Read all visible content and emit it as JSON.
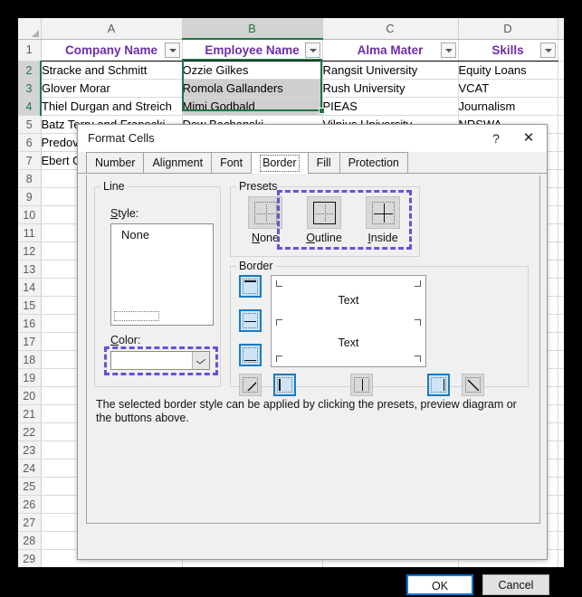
{
  "spreadsheet": {
    "columns": [
      "A",
      "B",
      "C",
      "D"
    ],
    "selected_column": "B",
    "row_count": 30,
    "selected_rows": [
      2,
      3,
      4
    ],
    "headers": [
      "Company Name",
      "Employee Name",
      "Alma Mater",
      "Skills"
    ],
    "header_text_color": "#6f2da8",
    "selection_color": "#217346",
    "rows": [
      [
        "Stracke and Schmitt",
        "Ozzie Gilkes",
        "Rangsit University",
        "Equity Loans"
      ],
      [
        "Glover Morar",
        "Romola Gallanders",
        "Rush University",
        "VCAT"
      ],
      [
        "Thiel Durgan and Streich",
        "Mimi Godbald",
        " PIEAS",
        "Journalism"
      ],
      [
        "Batz Terry and Franecki",
        "Dew Bachanski",
        "Vilnius University",
        "NRSWA"
      ],
      [
        "Predov",
        "",
        "",
        ""
      ],
      [
        "Ebert G",
        "",
        "",
        ""
      ]
    ],
    "filter_icon": "filter-dropdown-icon"
  },
  "dialog": {
    "title": "Format Cells",
    "help_icon": "?",
    "close_icon": "✕",
    "tabs": [
      {
        "label": "Number",
        "active": false
      },
      {
        "label": "Alignment",
        "active": false
      },
      {
        "label": "Font",
        "active": false
      },
      {
        "label": "Border",
        "active": true
      },
      {
        "label": "Fill",
        "active": false
      },
      {
        "label": "Protection",
        "active": false
      }
    ],
    "line_group": {
      "legend": "Line",
      "style_label": "Style:",
      "style_accel": "S",
      "style_options": [
        "None"
      ],
      "style_selected": "None",
      "color_label": "Color:",
      "color_accel": "C",
      "color_value": ""
    },
    "presets_group": {
      "legend": "Presets",
      "items": [
        {
          "label": "None",
          "accel": "N",
          "icon": "preset-none-icon"
        },
        {
          "label": "Outline",
          "accel": "O",
          "icon": "preset-outline-icon"
        },
        {
          "label": "Inside",
          "accel": "I",
          "icon": "preset-inside-icon"
        }
      ]
    },
    "border_group": {
      "legend": "Border",
      "preview_text_1": "Text",
      "preview_text_2": "Text",
      "side_buttons": [
        {
          "name": "border-top-button",
          "selected": true
        },
        {
          "name": "border-horizontal-middle-button",
          "selected": true
        },
        {
          "name": "border-bottom-button",
          "selected": true
        }
      ],
      "bottom_buttons": [
        {
          "name": "border-diagonal-up-button",
          "selected": false
        },
        {
          "name": "border-left-button",
          "selected": true
        },
        {
          "name": "border-vertical-middle-button",
          "selected": false
        },
        {
          "name": "border-right-button",
          "selected": true
        },
        {
          "name": "border-diagonal-down-button",
          "selected": false
        }
      ]
    },
    "help_text": "The selected border style can be applied by clicking the presets, preview diagram or the buttons above.",
    "ok_label": "OK",
    "cancel_label": "Cancel"
  },
  "annotations": {
    "color": "#6a4fd8",
    "items": [
      "color-dropdown-highlight",
      "presets-outline-inside-highlight"
    ]
  }
}
